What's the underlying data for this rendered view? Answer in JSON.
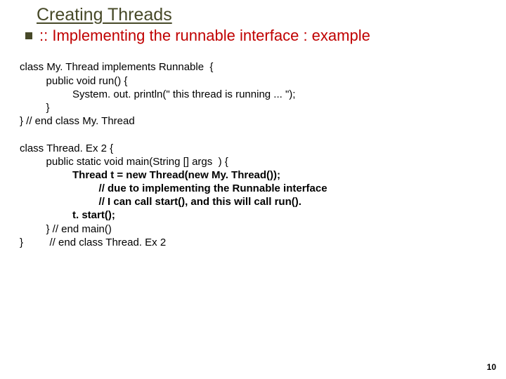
{
  "title": "Creating Threads",
  "subtitle": ":: Implementing the runnable interface : example",
  "code": {
    "l1": "class My. Thread implements Runnable  {",
    "l2": "         public void run() {",
    "l3": "                  System. out. println(\" this thread is running ... \");",
    "l4": "         }",
    "l5": "} // end class My. Thread",
    "l6": "",
    "l7": "class Thread. Ex 2 {",
    "l8": "         public static void main(String [] args  ) {",
    "l9": "                  Thread t = new Thread(new My. Thread()); ",
    "l10": "                           // due to implementing the Runnable interface",
    "l11": "                           // I can call start(), and this will call run().",
    "l12": "                  t. start();",
    "l13": "         } // end main()",
    "l14": "}         // end class Thread. Ex 2"
  },
  "page": "10"
}
